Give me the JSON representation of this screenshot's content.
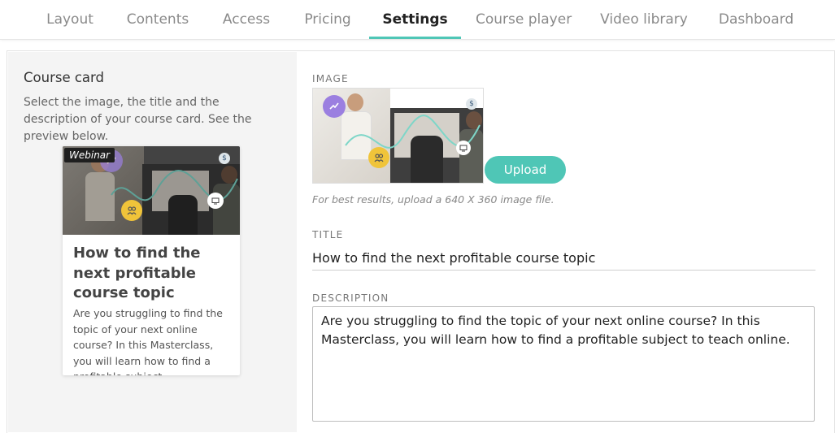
{
  "tabs": [
    {
      "label": "Layout",
      "active": false
    },
    {
      "label": "Contents",
      "active": false
    },
    {
      "label": "Access",
      "active": false
    },
    {
      "label": "Pricing",
      "active": false
    },
    {
      "label": "Settings",
      "active": true
    },
    {
      "label": "Course player",
      "active": false
    },
    {
      "label": "Video library",
      "active": false
    },
    {
      "label": "Dashboard",
      "active": false
    }
  ],
  "course_card": {
    "title": "Course card",
    "description": "Select the image, the title and the description of your course card. See the preview below."
  },
  "preview_card": {
    "badge": "Webinar",
    "title": "How to find the next profitable course topic",
    "description": "Are you struggling to find the topic of your next online course? In this Masterclass, you will learn how to find a profitable subject"
  },
  "image_field": {
    "label": "IMAGE",
    "upload_label": "Upload",
    "hint": "For best results, upload a 640 X 360 image file."
  },
  "title_field": {
    "label": "TITLE",
    "value": "How to find the next profitable course topic"
  },
  "description_field": {
    "label": "DESCRIPTION",
    "value": "Are you struggling to find the topic of your next online course? In this Masterclass, you will learn how to find a profitable subject to teach online."
  },
  "colors": {
    "accent": "#4fc6b6",
    "icon_purple": "#9b7fe0",
    "icon_yellow": "#f0c43a"
  },
  "icons": [
    "trend-up-icon",
    "people-icon",
    "screen-icon",
    "dollar-icon"
  ]
}
